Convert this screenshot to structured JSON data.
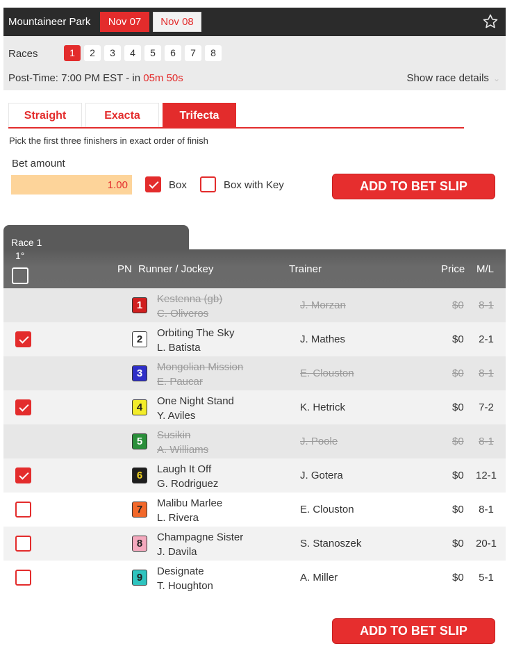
{
  "header": {
    "track": "Mountaineer Park",
    "dates": [
      "Nov 07",
      "Nov 08"
    ],
    "star_icon": "star-outline-icon"
  },
  "races": {
    "label": "Races",
    "numbers": [
      "1",
      "2",
      "3",
      "4",
      "5",
      "6",
      "7",
      "8"
    ],
    "selected": "1"
  },
  "post_time": {
    "prefix": "Post-Time: 7:00 PM EST - in ",
    "countdown": "05m 50s",
    "details_link": "Show race details"
  },
  "bet_types": {
    "tabs": [
      "Straight",
      "Exacta",
      "Trifecta"
    ],
    "selected": "Trifecta",
    "instruction": "Pick the first three finishers in exact order of finish"
  },
  "bet": {
    "amount_label": "Bet amount",
    "amount_value": "1.00",
    "box_label": "Box",
    "box_checked": true,
    "box_key_label": "Box with Key",
    "box_key_checked": false,
    "add_button": "ADD TO BET SLIP"
  },
  "table": {
    "race_title": "Race 1",
    "first_label": "1°",
    "headers": {
      "pn": "PN",
      "runner": "Runner / Jockey",
      "trainer": "Trainer",
      "price": "Price",
      "ml": "M/L"
    }
  },
  "runners": [
    {
      "pn": "1",
      "horse": "Kestenna (gb)",
      "jockey": "C. Oliveros",
      "trainer": "J. Morzan",
      "price": "$0",
      "ml": "8-1",
      "scratched": true,
      "checked": false,
      "color": "#d11f1f",
      "text_color": "#ffffff"
    },
    {
      "pn": "2",
      "horse": "Orbiting The Sky",
      "jockey": "L. Batista",
      "trainer": "J. Mathes",
      "price": "$0",
      "ml": "2-1",
      "scratched": false,
      "checked": true,
      "color": "#ffffff",
      "text_color": "#222222"
    },
    {
      "pn": "3",
      "horse": "Mongolian Mission",
      "jockey": "E. Paucar",
      "trainer": "E. Clouston",
      "price": "$0",
      "ml": "8-1",
      "scratched": true,
      "checked": false,
      "color": "#2f2fc8",
      "text_color": "#ffffff"
    },
    {
      "pn": "4",
      "horse": "One Night Stand",
      "jockey": "Y. Aviles",
      "trainer": "K. Hetrick",
      "price": "$0",
      "ml": "7-2",
      "scratched": false,
      "checked": true,
      "color": "#f2ec2a",
      "text_color": "#222222"
    },
    {
      "pn": "5",
      "horse": "Susikin",
      "jockey": "A. Williams",
      "trainer": "J. Poole",
      "price": "$0",
      "ml": "8-1",
      "scratched": true,
      "checked": false,
      "color": "#2a8f3a",
      "text_color": "#ffffff"
    },
    {
      "pn": "6",
      "horse": "Laugh It Off",
      "jockey": "G. Rodriguez",
      "trainer": "J. Gotera",
      "price": "$0",
      "ml": "12-1",
      "scratched": false,
      "checked": true,
      "color": "#1e1e1e",
      "text_color": "#f2d41f"
    },
    {
      "pn": "7",
      "horse": "Malibu Marlee",
      "jockey": "L. Rivera",
      "trainer": "E. Clouston",
      "price": "$0",
      "ml": "8-1",
      "scratched": false,
      "checked": false,
      "color": "#f2682a",
      "text_color": "#222222"
    },
    {
      "pn": "8",
      "horse": "Champagne Sister",
      "jockey": "J. Davila",
      "trainer": "S. Stanoszek",
      "price": "$0",
      "ml": "20-1",
      "scratched": false,
      "checked": false,
      "color": "#f4a9be",
      "text_color": "#222222"
    },
    {
      "pn": "9",
      "horse": "Designate",
      "jockey": "T. Houghton",
      "trainer": "A. Miller",
      "price": "$0",
      "ml": "5-1",
      "scratched": false,
      "checked": false,
      "color": "#2ec4bf",
      "text_color": "#222222"
    }
  ]
}
